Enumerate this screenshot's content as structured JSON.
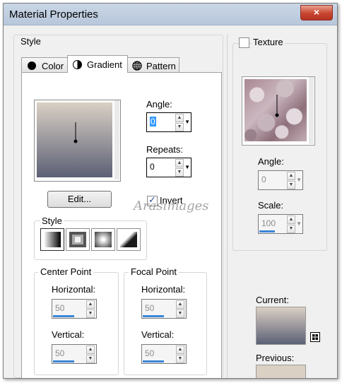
{
  "window": {
    "title": "Material Properties",
    "close_glyph": "×"
  },
  "style_group": {
    "label": "Style"
  },
  "tabs": [
    {
      "label": "Color",
      "icon": "black-circle-icon"
    },
    {
      "label": "Gradient",
      "icon": "half-circle-icon",
      "active": true
    },
    {
      "label": "Pattern",
      "icon": "globe-grid-icon"
    }
  ],
  "gradient": {
    "colors": {
      "top": "#dad0c4",
      "bottom": "#5c6076"
    },
    "edit_label": "Edit...",
    "angle_label": "Angle:",
    "angle_value": "0",
    "repeats_label": "Repeats:",
    "repeats_value": "0",
    "invert_label": "Invert",
    "invert_checked": true,
    "style_label": "Style",
    "styles": [
      "linear",
      "rectangular",
      "sunburst",
      "radial"
    ],
    "center_point": {
      "label": "Center Point",
      "horizontal_label": "Horizontal:",
      "horizontal_value": "50",
      "vertical_label": "Vertical:",
      "vertical_value": "50"
    },
    "focal_point": {
      "label": "Focal Point",
      "horizontal_label": "Horizontal:",
      "horizontal_value": "50",
      "vertical_label": "Vertical:",
      "vertical_value": "50"
    }
  },
  "watermark": "Arasimages",
  "texture": {
    "label": "Texture",
    "checked": false,
    "angle_label": "Angle:",
    "angle_value": "0",
    "scale_label": "Scale:",
    "scale_value": "100"
  },
  "swatches": {
    "current_label": "Current:",
    "previous_label": "Previous:"
  }
}
